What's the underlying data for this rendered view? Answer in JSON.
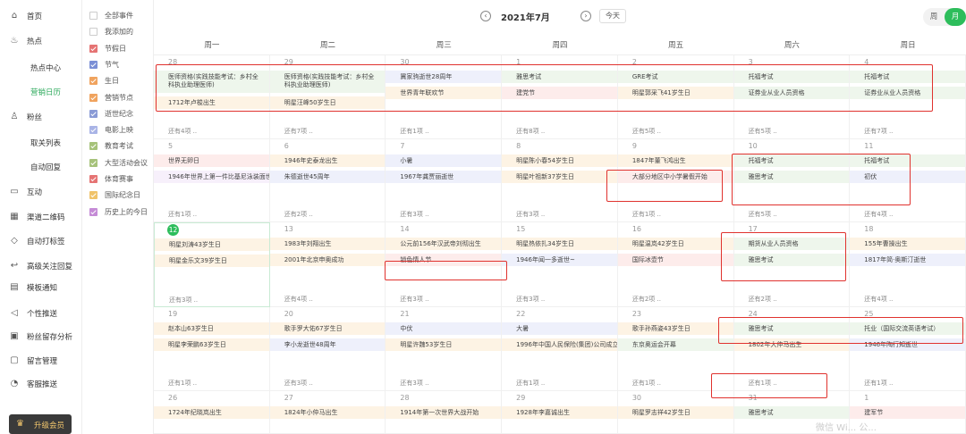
{
  "nav": [
    {
      "label": "首页",
      "icon": "home-icon",
      "glyph": "⌂",
      "sub": false,
      "active": false
    },
    {
      "label": "热点",
      "icon": "fire-icon",
      "glyph": "♨",
      "sub": false,
      "active": false
    },
    {
      "label": "热点中心",
      "icon": "",
      "glyph": "",
      "sub": true,
      "active": false
    },
    {
      "label": "营销日历",
      "icon": "",
      "glyph": "",
      "sub": true,
      "active": true
    },
    {
      "label": "粉丝",
      "icon": "user-icon",
      "glyph": "♙",
      "sub": false,
      "active": false
    },
    {
      "label": "取关列表",
      "icon": "",
      "glyph": "",
      "sub": true,
      "active": false
    },
    {
      "label": "自动回复",
      "icon": "",
      "glyph": "",
      "sub": true,
      "active": false
    },
    {
      "label": "互动",
      "icon": "chat-icon",
      "glyph": "▭",
      "sub": false,
      "active": false
    },
    {
      "label": "渠道二维码",
      "icon": "qrcode-icon",
      "glyph": "▦",
      "sub": false,
      "active": false
    },
    {
      "label": "自动打标签",
      "icon": "tag-icon",
      "glyph": "◇",
      "sub": false,
      "active": false
    },
    {
      "label": "高级关注回复",
      "icon": "reply-icon",
      "glyph": "↩",
      "sub": false,
      "active": false
    },
    {
      "label": "模板通知",
      "icon": "template-icon",
      "glyph": "▤",
      "sub": false,
      "active": false
    },
    {
      "label": "个性推送",
      "icon": "send-icon",
      "glyph": "◁",
      "sub": false,
      "active": false
    },
    {
      "label": "粉丝留存分析",
      "icon": "analysis-icon",
      "glyph": "▣",
      "sub": false,
      "active": false
    },
    {
      "label": "留言管理",
      "icon": "message-icon",
      "glyph": "▢",
      "sub": false,
      "active": false
    },
    {
      "label": "客服推送",
      "icon": "service-icon",
      "glyph": "◔",
      "sub": false,
      "active": false
    }
  ],
  "vip": {
    "label": "升级会员",
    "icon": "crown-icon",
    "glyph": "♛"
  },
  "filters": [
    {
      "label": "全部事件",
      "checked": false,
      "color": ""
    },
    {
      "label": "我添加的",
      "checked": false,
      "color": ""
    },
    {
      "label": "节假日",
      "checked": true,
      "color": "#e57373"
    },
    {
      "label": "节气",
      "checked": true,
      "color": "#7b8fd6"
    },
    {
      "label": "生日",
      "checked": true,
      "color": "#f0a35e"
    },
    {
      "label": "营销节点",
      "checked": true,
      "color": "#f0a35e"
    },
    {
      "label": "逝世纪念",
      "checked": true,
      "color": "#8a9bd6"
    },
    {
      "label": "电影上映",
      "checked": true,
      "color": "#a9b4e6"
    },
    {
      "label": "教育考试",
      "checked": true,
      "color": "#a6c27a"
    },
    {
      "label": "大型活动会议",
      "checked": true,
      "color": "#a6c27a"
    },
    {
      "label": "体育赛事",
      "checked": true,
      "color": "#e57373"
    },
    {
      "label": "国际纪念日",
      "checked": true,
      "color": "#f0c36a"
    },
    {
      "label": "历史上的今日",
      "checked": true,
      "color": "#c58bd6"
    }
  ],
  "toolbar": {
    "title": "2021年7月",
    "prev": "‹",
    "next": "›",
    "today": "今天",
    "view_week": "周",
    "view_month": "月"
  },
  "weekdays": [
    "周一",
    "周二",
    "周三",
    "周四",
    "周五",
    "周六",
    "周日"
  ],
  "colors": {
    "y": "#fdf3e4",
    "b": "#eef0fb",
    "g": "#eef6ec",
    "r": "#fdeceb",
    "p": "#f7f0fb"
  },
  "weeks": [
    [
      {
        "day": "28",
        "events": [
          {
            "text": "医师资格(实践技能考试：乡村全科执业助理医师)",
            "color": "g",
            "tall": true
          },
          {
            "text": "1712年卢梭出生",
            "color": "y"
          }
        ],
        "more": "还有4项 .."
      },
      {
        "day": "29",
        "events": [
          {
            "text": "医师资格(实践技能考试：乡村全科执业助理医师)",
            "color": "g",
            "tall": true
          },
          {
            "text": "明星汪峰50岁生日",
            "color": "y"
          }
        ],
        "more": "还有7项 .."
      },
      {
        "day": "30",
        "events": [
          {
            "text": "冀家驹逝世28周年",
            "color": "b"
          },
          {
            "text": "世界青年联欢节",
            "color": "y"
          }
        ],
        "more": "还有1项 .."
      },
      {
        "day": "1",
        "events": [
          {
            "text": "雅思考试",
            "color": "g"
          },
          {
            "text": "建党节",
            "color": "r"
          }
        ],
        "more": "还有8项 .."
      },
      {
        "day": "2",
        "events": [
          {
            "text": "GRE考试",
            "color": "g"
          },
          {
            "text": "明星郭采飞41岁生日",
            "color": "y"
          }
        ],
        "more": "还有5项 .."
      },
      {
        "day": "3",
        "events": [
          {
            "text": "托福考试",
            "color": "g"
          },
          {
            "text": "证券业从业人员资格",
            "color": "g"
          }
        ],
        "more": "还有5项 .."
      },
      {
        "day": "4",
        "events": [
          {
            "text": "托福考试",
            "color": "g"
          },
          {
            "text": "证券业从业人员资格",
            "color": "g"
          }
        ],
        "more": "还有7项 .."
      }
    ],
    [
      {
        "day": "5",
        "events": [
          {
            "text": "世界无卵日",
            "color": "r"
          },
          {
            "text": "1946年世界上第一件比基尼泳装面世",
            "color": "p"
          }
        ],
        "more": "还有1项 .."
      },
      {
        "day": "6",
        "events": [
          {
            "text": "1946年史泰龙出生",
            "color": "y"
          },
          {
            "text": "朱德逝世45周年",
            "color": "b"
          }
        ],
        "more": "还有2项 .."
      },
      {
        "day": "7",
        "events": [
          {
            "text": "小暑",
            "color": "b"
          },
          {
            "text": "1967年龚贾丽逝世",
            "color": "b"
          }
        ],
        "more": "还有3项 .."
      },
      {
        "day": "8",
        "events": [
          {
            "text": "明星陈小春54岁生日",
            "color": "y"
          },
          {
            "text": "明星叶祖新37岁生日",
            "color": "y"
          }
        ],
        "more": "还有3项 .."
      },
      {
        "day": "9",
        "events": [
          {
            "text": "1847年董飞鸿出生",
            "color": "y"
          },
          {
            "text": "大部分地区中小学暑假开始",
            "color": "r"
          }
        ],
        "more": "还有1项 .."
      },
      {
        "day": "10",
        "events": [
          {
            "text": "托福考试",
            "color": "g"
          },
          {
            "text": "雅思考试",
            "color": "g"
          }
        ],
        "more": "还有5项 .."
      },
      {
        "day": "11",
        "events": [
          {
            "text": "托福考试",
            "color": "g"
          },
          {
            "text": "初伏",
            "color": "b"
          }
        ],
        "more": "还有4项 .."
      }
    ],
    [
      {
        "day": "12",
        "today": true,
        "events": [
          {
            "text": "明星刘涛43岁生日",
            "color": "y"
          },
          {
            "text": "明星金乐文39岁生日",
            "color": "y"
          }
        ],
        "more": "还有3项 .."
      },
      {
        "day": "13",
        "events": [
          {
            "text": "1983年刘翔出生",
            "color": "y"
          },
          {
            "text": "2001年北京申奥成功",
            "color": "y"
          }
        ],
        "more": "还有4项 .."
      },
      {
        "day": "14",
        "events": [
          {
            "text": "公元前156年汉武帝刘彻出生",
            "color": "y"
          },
          {
            "text": "锁色情人节",
            "color": "r"
          }
        ],
        "more": "还有3项 .."
      },
      {
        "day": "15",
        "events": [
          {
            "text": "明星热依扎34岁生日",
            "color": "y"
          },
          {
            "text": "1946年闻一多逝世~",
            "color": "b"
          }
        ],
        "more": "还有3项 .."
      },
      {
        "day": "16",
        "events": [
          {
            "text": "明星温岚42岁生日",
            "color": "y"
          },
          {
            "text": "国际冰壶节",
            "color": "r"
          }
        ],
        "more": "还有2项 .."
      },
      {
        "day": "17",
        "events": [
          {
            "text": "期货从业人员资格",
            "color": "g"
          },
          {
            "text": "雅思考试",
            "color": "g"
          }
        ],
        "more": "还有2项 .."
      },
      {
        "day": "18",
        "events": [
          {
            "text": "155年曹操出生",
            "color": "y"
          },
          {
            "text": "1817年简·奥斯汀逝世",
            "color": "b"
          }
        ],
        "more": "还有4项 .."
      }
    ],
    [
      {
        "day": "19",
        "events": [
          {
            "text": "赵本山63岁生日",
            "color": "y"
          },
          {
            "text": "明星李荣鹏63岁生日",
            "color": "y"
          }
        ],
        "more": "还有1项 .."
      },
      {
        "day": "20",
        "events": [
          {
            "text": "歌手罗大佑67岁生日",
            "color": "y"
          },
          {
            "text": "李小龙逝世48周年",
            "color": "b"
          }
        ],
        "more": "还有3项 .."
      },
      {
        "day": "21",
        "events": [
          {
            "text": "中伏",
            "color": "b"
          },
          {
            "text": "明星许魏53岁生日",
            "color": "y"
          }
        ],
        "more": "还有3项 .."
      },
      {
        "day": "22",
        "events": [
          {
            "text": "大暑",
            "color": "b"
          },
          {
            "text": "1996年中国人民保险(集团)公司成立",
            "color": "y"
          }
        ],
        "more": "还有1项 .."
      },
      {
        "day": "23",
        "events": [
          {
            "text": "歌手孙燕姿43岁生日",
            "color": "y"
          },
          {
            "text": "东京奥运会开幕",
            "color": "g"
          }
        ],
        "more": "还有1项 .."
      },
      {
        "day": "24",
        "events": [
          {
            "text": "雅思考试",
            "color": "g"
          },
          {
            "text": "1802年大仲马出生",
            "color": "y"
          }
        ],
        "more": "还有1项 .."
      },
      {
        "day": "25",
        "events": [
          {
            "text": "托业（国际交流英语考试）",
            "color": "g"
          },
          {
            "text": "1946年陶行知逝世",
            "color": "b"
          }
        ],
        "more": "还有1项 .."
      }
    ],
    [
      {
        "day": "26",
        "events": [
          {
            "text": "1724年纪晓岚出生",
            "color": "y"
          }
        ],
        "more": ""
      },
      {
        "day": "27",
        "events": [
          {
            "text": "1824年小仲马出生",
            "color": "y"
          }
        ],
        "more": ""
      },
      {
        "day": "28",
        "events": [
          {
            "text": "1914年第一次世界大战开始",
            "color": "y"
          }
        ],
        "more": ""
      },
      {
        "day": "29",
        "events": [
          {
            "text": "1928年李嘉诚出生",
            "color": "y"
          }
        ],
        "more": ""
      },
      {
        "day": "30",
        "events": [
          {
            "text": "明星罗志祥42岁生日",
            "color": "y"
          }
        ],
        "more": ""
      },
      {
        "day": "31",
        "events": [
          {
            "text": "雅思考试",
            "color": "g"
          }
        ],
        "more": ""
      },
      {
        "day": "1",
        "events": [
          {
            "text": "建军节",
            "color": "r"
          }
        ],
        "more": ""
      }
    ]
  ],
  "watermark": "微信 Wi... 公..."
}
